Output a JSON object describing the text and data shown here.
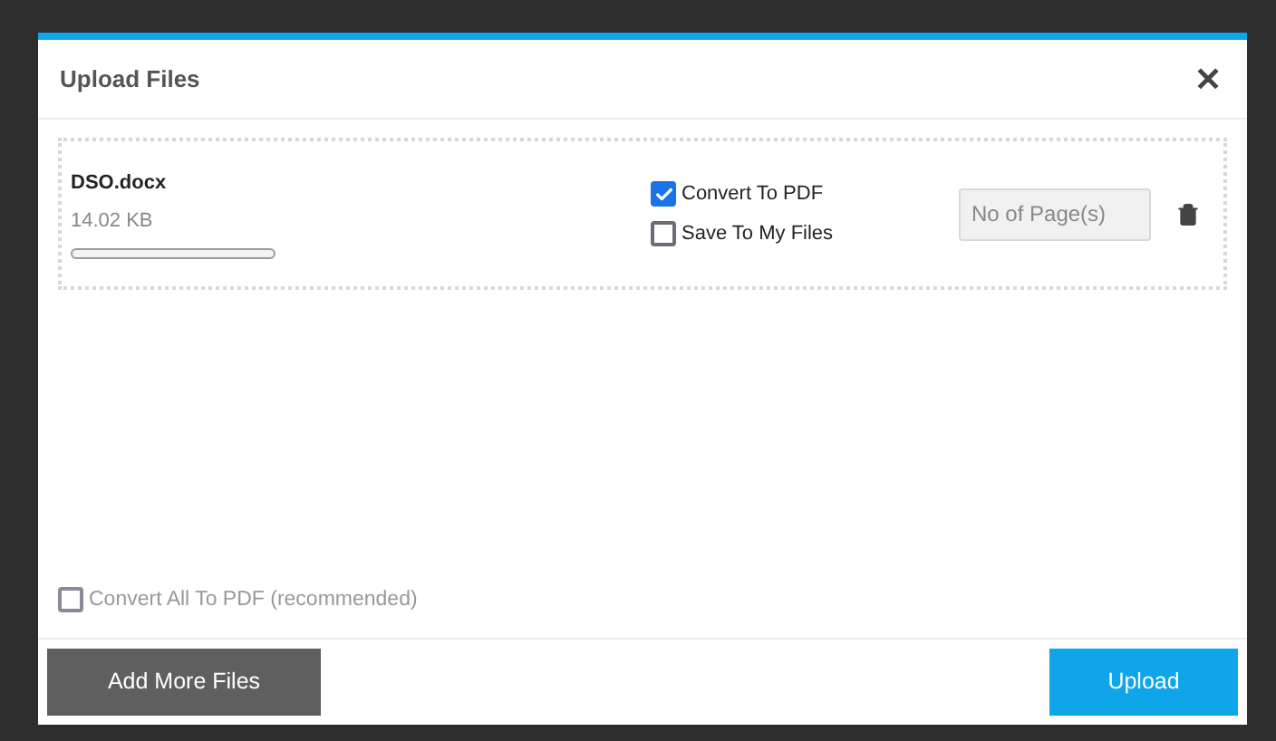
{
  "dialog": {
    "title": "Upload Files",
    "close": "✕"
  },
  "files": [
    {
      "name": "DSO.docx",
      "size": "14.02 KB",
      "level": 0,
      "options": [
        {
          "label": "Convert To PDF",
          "checked": true
        },
        {
          "label": "Save To My Files",
          "checked": false
        }
      ],
      "pages": {
        "placeholder": "No of Page(s)"
      }
    }
  ],
  "convert_all": {
    "label": "Convert All To PDF (recommended)",
    "checked": false,
    "disabled": true
  },
  "buttons": {
    "add_more": "Add More Files",
    "upload": "Upload"
  }
}
